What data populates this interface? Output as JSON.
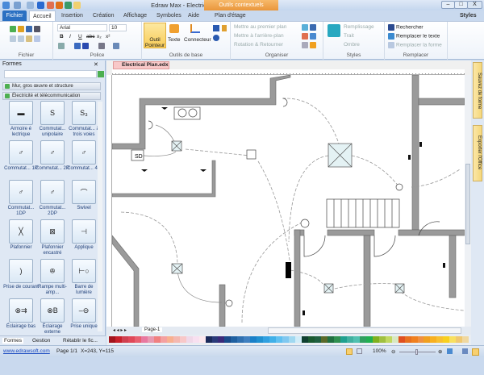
{
  "window": {
    "title": "Edraw Max - Electrical Plan.edx",
    "contextual": "Outils contextuels",
    "controls": [
      "–",
      "□",
      "X"
    ]
  },
  "tabs": [
    "Fichier",
    "Accueil",
    "Insertion",
    "Création",
    "Affichage",
    "Symboles",
    "Aide",
    "Plan d'étage"
  ],
  "styles_menu": "Styles",
  "ribbon": {
    "fichier": {
      "label": "Fichier"
    },
    "police": {
      "label": "Police",
      "font": "Arial",
      "size": "10",
      "format": [
        "B",
        "I",
        "U",
        "abc",
        "x₂",
        "x²"
      ]
    },
    "outils": {
      "label": "Outils de base",
      "pointer": "Outil Pointeur",
      "text": "Texte",
      "connector": "Connecteur"
    },
    "organiser": {
      "label": "Organiser",
      "items": [
        "Mettre au premier plan",
        "Mettre à l'arrière-plan",
        "Rotation & Retourner"
      ]
    },
    "styles": {
      "label": "Styles",
      "items": [
        "Remplissage",
        "Trait",
        "Ombre"
      ]
    },
    "remplacer": {
      "label": "Remplacer",
      "items": [
        "Rechercher",
        "Remplacer le texte",
        "Remplacer la forme"
      ]
    }
  },
  "panel": {
    "title": "Formes",
    "categories": [
      "Mur, gros œuvre et structure",
      "Électricité et télécommunication"
    ],
    "shapes": [
      {
        "label": "Armoire é lectrique",
        "glyph": "▬"
      },
      {
        "label": "Commutat... unipolaire",
        "glyph": "S"
      },
      {
        "label": "Commutat... à trois voies",
        "glyph": "S₃"
      },
      {
        "label": "Commutat... 1P",
        "glyph": "♂"
      },
      {
        "label": "Commutat... 2P",
        "glyph": "♂"
      },
      {
        "label": "Commutat... 4P",
        "glyph": "♂"
      },
      {
        "label": "Commutat... 1DP",
        "glyph": "♂"
      },
      {
        "label": "Commutat... 2DP",
        "glyph": "♂"
      },
      {
        "label": "Swivel",
        "glyph": "⌒"
      },
      {
        "label": "Plafonnier",
        "glyph": "╳"
      },
      {
        "label": "Plafonnier encastré",
        "glyph": "⊠"
      },
      {
        "label": "Applique",
        "glyph": "⊣"
      },
      {
        "label": "Prise de courant",
        "glyph": ")"
      },
      {
        "label": "Rampe multi-amp...",
        "glyph": "ꔮ"
      },
      {
        "label": "Barre de lumière",
        "glyph": "⊢○"
      },
      {
        "label": "Éclairage bas",
        "glyph": "⊗⇉"
      },
      {
        "label": "Éclairage externe",
        "glyph": "⊗B"
      },
      {
        "label": "Prise unique",
        "glyph": "–⊖"
      }
    ],
    "bottom_tabs": [
      "Formes",
      "Gestion",
      "Rétablir le fic..."
    ]
  },
  "document": {
    "tab": "Electrical Plan.edx",
    "page": "Page-1",
    "labels": {
      "sd": "SD"
    }
  },
  "right_tabs": [
    "Sauvez de forme",
    "Exporter l'Office"
  ],
  "status": {
    "link": "www.edrawsoft.com",
    "page": "Page 1/1",
    "coords": "X=243, Y=115",
    "zoom": "100%"
  },
  "palette": [
    "#a3141c",
    "#c8202a",
    "#d04050",
    "#e04858",
    "#e86070",
    "#e878a0",
    "#e898b0",
    "#f08080",
    "#f4a0a0",
    "#f8b090",
    "#f4b8b0",
    "#f8c8c8",
    "#f0d8e8",
    "#f8e0f0",
    "#fce8ee",
    "#1a2a5a",
    "#2a3a7a",
    "#3a2a7a",
    "#1a4a8a",
    "#2060a0",
    "#3070b0",
    "#4080c0",
    "#1a80c8",
    "#2090d0",
    "#30a0e0",
    "#40b0e8",
    "#60c0f0",
    "#80c8f0",
    "#a0d8f0",
    "#d0ecf8",
    "#104030",
    "#1a5a30",
    "#206040",
    "#5a6a2a",
    "#207040",
    "#309050",
    "#20a090",
    "#40b0a0",
    "#50c0b0",
    "#30a060",
    "#20b050",
    "#80b020",
    "#a0c040",
    "#c0d860",
    "#d8e8c0",
    "#e05020",
    "#e87020",
    "#f08020",
    "#f09040",
    "#f0a020",
    "#f8b020",
    "#f8c030",
    "#f8d020",
    "#f8e060",
    "#f0c870",
    "#f0d8a0"
  ]
}
